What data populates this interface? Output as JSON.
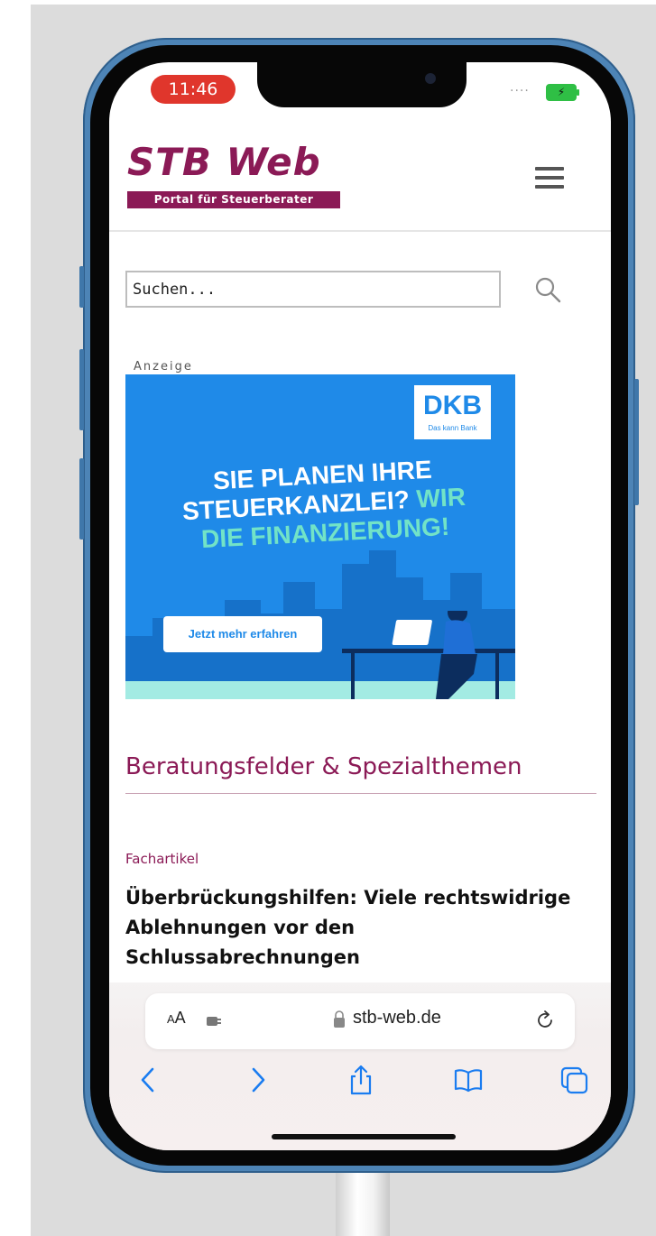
{
  "status_bar": {
    "time": "11:46",
    "signal": "....",
    "battery_icon": "battery-charging-icon"
  },
  "header": {
    "site_title": "STB Web",
    "tagline": "Portal für Steuerberater",
    "menu_icon": "hamburger-menu-icon"
  },
  "search": {
    "placeholder": "Suchen...",
    "value": "",
    "icon": "search-icon"
  },
  "ad": {
    "label": "Anzeige",
    "brand": "DKB",
    "brand_tagline": "Das kann Bank",
    "headline_line1": "SIE PLANEN IHRE",
    "headline_line2": "STEUERKANZLEI?",
    "headline_accent_line2": "WIR",
    "headline_line3": "DIE FINANZIERUNG!",
    "cta": "Jetzt mehr erfahren"
  },
  "section": {
    "title": "Beratungsfelder & Spezialthemen"
  },
  "article": {
    "category": "Fachartikel",
    "title": "Überbrückungshilfen: Viele rechtswidrige Ablehnungen vor den Schlussabrechnungen"
  },
  "browser": {
    "text_size_label_large": "A",
    "text_size_label_small": "A",
    "domain": "stb-web.de",
    "toolbar_icons": [
      "back-icon",
      "forward-icon",
      "share-icon",
      "bookmarks-icon",
      "tabs-icon"
    ]
  },
  "colors": {
    "brand": "#8b1a56",
    "ios_blue": "#1a7cf0",
    "ad_blue": "#1f8ae8",
    "ad_accent": "#72e3c7",
    "phone_frame": "#4d84b6"
  }
}
